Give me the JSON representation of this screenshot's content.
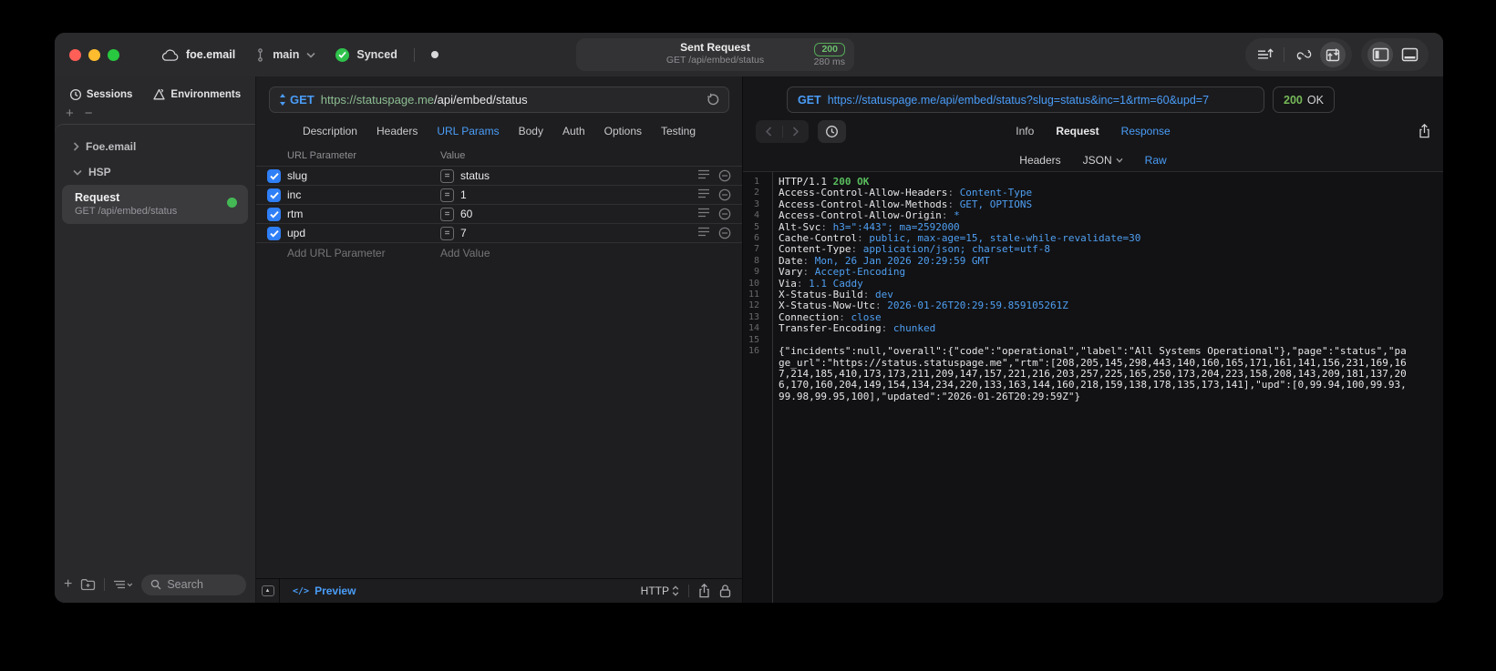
{
  "titlebar": {
    "project": "foe.email",
    "branch": "main",
    "sync_label": "Synced",
    "request_summary": {
      "title": "Sent Request",
      "subtitle": "GET /api/embed/status",
      "status_code": "200",
      "duration": "280 ms"
    }
  },
  "sidebar": {
    "tabs": [
      {
        "label": "Sessions"
      },
      {
        "label": "Environments"
      }
    ],
    "tree": [
      {
        "label": "Foe.email"
      },
      {
        "label": "HSP"
      }
    ],
    "request_item": {
      "title": "Request",
      "subtitle": "GET /api/embed/status"
    },
    "search_placeholder": "Search"
  },
  "request_editor": {
    "method": "GET",
    "url_host": "https://statuspage.me",
    "url_path": "/api/embed/status",
    "tabs": [
      "Description",
      "Headers",
      "URL Params",
      "Body",
      "Auth",
      "Options",
      "Testing"
    ],
    "active_tab": "URL Params",
    "params": {
      "columns": [
        "URL Parameter",
        "Value"
      ],
      "rows": [
        {
          "name": "slug",
          "value": "status",
          "checked": true
        },
        {
          "name": "inc",
          "value": "1",
          "checked": true
        },
        {
          "name": "rtm",
          "value": "60",
          "checked": true
        },
        {
          "name": "upd",
          "value": "7",
          "checked": true
        }
      ],
      "add_name_placeholder": "Add URL Parameter",
      "add_value_placeholder": "Add Value"
    },
    "footer": {
      "preview_label": "Preview",
      "code_glyph": "</>",
      "protocol": "HTTP"
    }
  },
  "response_viewer": {
    "method": "GET",
    "url": "https://statuspage.me/api/embed/status?slug=status&inc=1&rtm=60&upd=7",
    "status_code": "200",
    "status_text": "OK",
    "tabs": [
      "Info",
      "Request",
      "Response"
    ],
    "active_tab": "Response",
    "subtabs": [
      "Headers",
      "JSON",
      "Raw"
    ],
    "active_subtab": "Raw",
    "body_lines": [
      {
        "n": "1",
        "parts": [
          {
            "t": "HTTP/1.1 ",
            "c": "plain"
          },
          {
            "t": "200 OK",
            "c": "green"
          }
        ]
      },
      {
        "n": "2",
        "parts": [
          {
            "t": "Access-Control-Allow-Headers",
            "c": "key"
          },
          {
            "t": ": ",
            "c": "sep"
          },
          {
            "t": "Content-Type",
            "c": "val"
          }
        ]
      },
      {
        "n": "3",
        "parts": [
          {
            "t": "Access-Control-Allow-Methods",
            "c": "key"
          },
          {
            "t": ": ",
            "c": "sep"
          },
          {
            "t": "GET, OPTIONS",
            "c": "val"
          }
        ]
      },
      {
        "n": "4",
        "parts": [
          {
            "t": "Access-Control-Allow-Origin",
            "c": "key"
          },
          {
            "t": ": ",
            "c": "sep"
          },
          {
            "t": "*",
            "c": "val"
          }
        ]
      },
      {
        "n": "5",
        "parts": [
          {
            "t": "Alt-Svc",
            "c": "key"
          },
          {
            "t": ": ",
            "c": "sep"
          },
          {
            "t": "h3=\":443\"; ma=2592000",
            "c": "val"
          }
        ]
      },
      {
        "n": "6",
        "parts": [
          {
            "t": "Cache-Control",
            "c": "key"
          },
          {
            "t": ": ",
            "c": "sep"
          },
          {
            "t": "public, max-age=15, stale-while-revalidate=30",
            "c": "val"
          }
        ]
      },
      {
        "n": "7",
        "parts": [
          {
            "t": "Content-Type",
            "c": "key"
          },
          {
            "t": ": ",
            "c": "sep"
          },
          {
            "t": "application/json; charset=utf-8",
            "c": "val"
          }
        ]
      },
      {
        "n": "8",
        "parts": [
          {
            "t": "Date",
            "c": "key"
          },
          {
            "t": ": ",
            "c": "sep"
          },
          {
            "t": "Mon, 26 Jan 2026 20:29:59 GMT",
            "c": "val"
          }
        ]
      },
      {
        "n": "9",
        "parts": [
          {
            "t": "Vary",
            "c": "key"
          },
          {
            "t": ": ",
            "c": "sep"
          },
          {
            "t": "Accept-Encoding",
            "c": "val"
          }
        ]
      },
      {
        "n": "10",
        "parts": [
          {
            "t": "Via",
            "c": "key"
          },
          {
            "t": ": ",
            "c": "sep"
          },
          {
            "t": "1.1 Caddy",
            "c": "val"
          }
        ]
      },
      {
        "n": "11",
        "parts": [
          {
            "t": "X-Status-Build",
            "c": "key"
          },
          {
            "t": ": ",
            "c": "sep"
          },
          {
            "t": "dev",
            "c": "val"
          }
        ]
      },
      {
        "n": "12",
        "parts": [
          {
            "t": "X-Status-Now-Utc",
            "c": "key"
          },
          {
            "t": ": ",
            "c": "sep"
          },
          {
            "t": "2026-01-26T20:29:59.859105261Z",
            "c": "val"
          }
        ]
      },
      {
        "n": "13",
        "parts": [
          {
            "t": "Connection",
            "c": "key"
          },
          {
            "t": ": ",
            "c": "sep"
          },
          {
            "t": "close",
            "c": "val"
          }
        ]
      },
      {
        "n": "14",
        "parts": [
          {
            "t": "Transfer-Encoding",
            "c": "key"
          },
          {
            "t": ": ",
            "c": "sep"
          },
          {
            "t": "chunked",
            "c": "val"
          }
        ]
      },
      {
        "n": "15",
        "parts": []
      },
      {
        "n": "16",
        "parts": [
          {
            "t": "{\"incidents\":null,\"overall\":{\"code\":\"operational\",\"label\":\"All Systems Operational\"},\"page\":\"status\",\"page_url\":\"https://status.statuspage.me\",\"rtm\":[208,205,145,298,443,140,160,165,171,161,141,156,231,169,167,214,185,410,173,173,211,209,147,157,221,216,203,257,225,165,250,173,204,223,158,208,143,209,181,137,206,170,160,204,149,154,134,234,220,133,163,144,160,218,159,138,178,135,173,141],\"upd\":[0,99.94,100,99.93,99.98,99.95,100],\"updated\":\"2026-01-26T20:29:59Z\"}",
            "c": "plain"
          }
        ]
      }
    ]
  },
  "colors": {
    "accent_blue": "#4a9df8",
    "status_green": "#59bf5e",
    "host_green": "#8dbd91"
  }
}
